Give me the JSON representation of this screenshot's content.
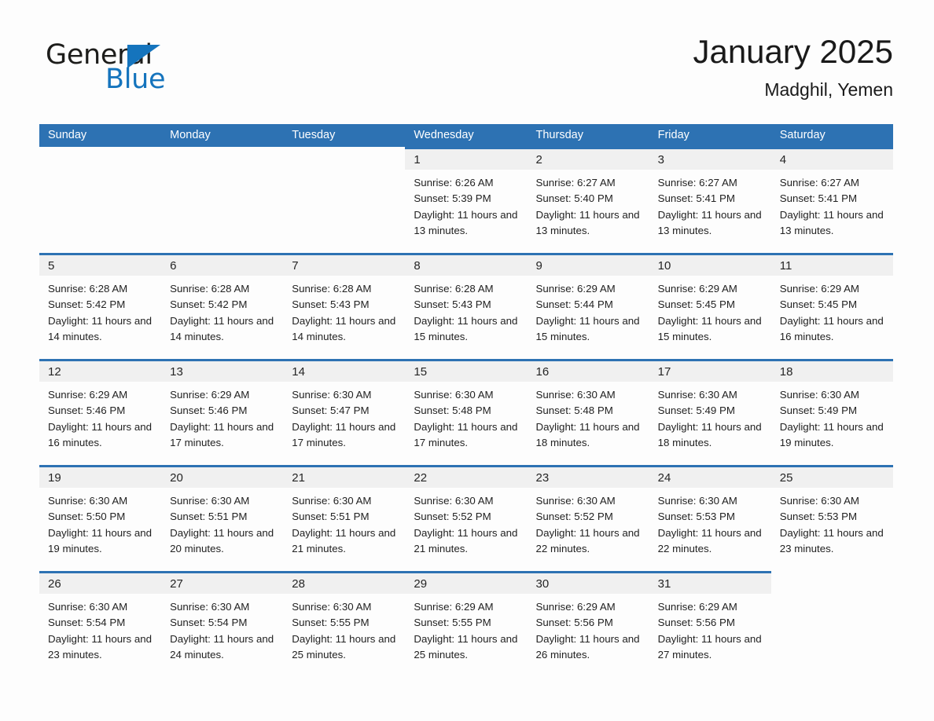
{
  "brand": {
    "name_part1": "General",
    "name_part2": "Blue",
    "accent_color": "#1574bd",
    "triangle_icon": "logo-triangle-icon"
  },
  "header": {
    "month_title": "January 2025",
    "location": "Madghil, Yemen"
  },
  "colors": {
    "header_blue": "#2d72b3",
    "daynum_band": "#f0f0f0",
    "page_background": "#fdfdfd",
    "text": "#222222"
  },
  "weekdays": [
    "Sunday",
    "Monday",
    "Tuesday",
    "Wednesday",
    "Thursday",
    "Friday",
    "Saturday"
  ],
  "weeks": [
    [
      {
        "day": "",
        "blank": true
      },
      {
        "day": "",
        "blank": true
      },
      {
        "day": "",
        "blank": true
      },
      {
        "day": "1",
        "sunrise": "Sunrise: 6:26 AM",
        "sunset": "Sunset: 5:39 PM",
        "daylight": "Daylight: 11 hours and 13 minutes."
      },
      {
        "day": "2",
        "sunrise": "Sunrise: 6:27 AM",
        "sunset": "Sunset: 5:40 PM",
        "daylight": "Daylight: 11 hours and 13 minutes."
      },
      {
        "day": "3",
        "sunrise": "Sunrise: 6:27 AM",
        "sunset": "Sunset: 5:41 PM",
        "daylight": "Daylight: 11 hours and 13 minutes."
      },
      {
        "day": "4",
        "sunrise": "Sunrise: 6:27 AM",
        "sunset": "Sunset: 5:41 PM",
        "daylight": "Daylight: 11 hours and 13 minutes."
      }
    ],
    [
      {
        "day": "5",
        "sunrise": "Sunrise: 6:28 AM",
        "sunset": "Sunset: 5:42 PM",
        "daylight": "Daylight: 11 hours and 14 minutes."
      },
      {
        "day": "6",
        "sunrise": "Sunrise: 6:28 AM",
        "sunset": "Sunset: 5:42 PM",
        "daylight": "Daylight: 11 hours and 14 minutes."
      },
      {
        "day": "7",
        "sunrise": "Sunrise: 6:28 AM",
        "sunset": "Sunset: 5:43 PM",
        "daylight": "Daylight: 11 hours and 14 minutes."
      },
      {
        "day": "8",
        "sunrise": "Sunrise: 6:28 AM",
        "sunset": "Sunset: 5:43 PM",
        "daylight": "Daylight: 11 hours and 15 minutes."
      },
      {
        "day": "9",
        "sunrise": "Sunrise: 6:29 AM",
        "sunset": "Sunset: 5:44 PM",
        "daylight": "Daylight: 11 hours and 15 minutes."
      },
      {
        "day": "10",
        "sunrise": "Sunrise: 6:29 AM",
        "sunset": "Sunset: 5:45 PM",
        "daylight": "Daylight: 11 hours and 15 minutes."
      },
      {
        "day": "11",
        "sunrise": "Sunrise: 6:29 AM",
        "sunset": "Sunset: 5:45 PM",
        "daylight": "Daylight: 11 hours and 16 minutes."
      }
    ],
    [
      {
        "day": "12",
        "sunrise": "Sunrise: 6:29 AM",
        "sunset": "Sunset: 5:46 PM",
        "daylight": "Daylight: 11 hours and 16 minutes."
      },
      {
        "day": "13",
        "sunrise": "Sunrise: 6:29 AM",
        "sunset": "Sunset: 5:46 PM",
        "daylight": "Daylight: 11 hours and 17 minutes."
      },
      {
        "day": "14",
        "sunrise": "Sunrise: 6:30 AM",
        "sunset": "Sunset: 5:47 PM",
        "daylight": "Daylight: 11 hours and 17 minutes."
      },
      {
        "day": "15",
        "sunrise": "Sunrise: 6:30 AM",
        "sunset": "Sunset: 5:48 PM",
        "daylight": "Daylight: 11 hours and 17 minutes."
      },
      {
        "day": "16",
        "sunrise": "Sunrise: 6:30 AM",
        "sunset": "Sunset: 5:48 PM",
        "daylight": "Daylight: 11 hours and 18 minutes."
      },
      {
        "day": "17",
        "sunrise": "Sunrise: 6:30 AM",
        "sunset": "Sunset: 5:49 PM",
        "daylight": "Daylight: 11 hours and 18 minutes."
      },
      {
        "day": "18",
        "sunrise": "Sunrise: 6:30 AM",
        "sunset": "Sunset: 5:49 PM",
        "daylight": "Daylight: 11 hours and 19 minutes."
      }
    ],
    [
      {
        "day": "19",
        "sunrise": "Sunrise: 6:30 AM",
        "sunset": "Sunset: 5:50 PM",
        "daylight": "Daylight: 11 hours and 19 minutes."
      },
      {
        "day": "20",
        "sunrise": "Sunrise: 6:30 AM",
        "sunset": "Sunset: 5:51 PM",
        "daylight": "Daylight: 11 hours and 20 minutes."
      },
      {
        "day": "21",
        "sunrise": "Sunrise: 6:30 AM",
        "sunset": "Sunset: 5:51 PM",
        "daylight": "Daylight: 11 hours and 21 minutes."
      },
      {
        "day": "22",
        "sunrise": "Sunrise: 6:30 AM",
        "sunset": "Sunset: 5:52 PM",
        "daylight": "Daylight: 11 hours and 21 minutes."
      },
      {
        "day": "23",
        "sunrise": "Sunrise: 6:30 AM",
        "sunset": "Sunset: 5:52 PM",
        "daylight": "Daylight: 11 hours and 22 minutes."
      },
      {
        "day": "24",
        "sunrise": "Sunrise: 6:30 AM",
        "sunset": "Sunset: 5:53 PM",
        "daylight": "Daylight: 11 hours and 22 minutes."
      },
      {
        "day": "25",
        "sunrise": "Sunrise: 6:30 AM",
        "sunset": "Sunset: 5:53 PM",
        "daylight": "Daylight: 11 hours and 23 minutes."
      }
    ],
    [
      {
        "day": "26",
        "sunrise": "Sunrise: 6:30 AM",
        "sunset": "Sunset: 5:54 PM",
        "daylight": "Daylight: 11 hours and 23 minutes."
      },
      {
        "day": "27",
        "sunrise": "Sunrise: 6:30 AM",
        "sunset": "Sunset: 5:54 PM",
        "daylight": "Daylight: 11 hours and 24 minutes."
      },
      {
        "day": "28",
        "sunrise": "Sunrise: 6:30 AM",
        "sunset": "Sunset: 5:55 PM",
        "daylight": "Daylight: 11 hours and 25 minutes."
      },
      {
        "day": "29",
        "sunrise": "Sunrise: 6:29 AM",
        "sunset": "Sunset: 5:55 PM",
        "daylight": "Daylight: 11 hours and 25 minutes."
      },
      {
        "day": "30",
        "sunrise": "Sunrise: 6:29 AM",
        "sunset": "Sunset: 5:56 PM",
        "daylight": "Daylight: 11 hours and 26 minutes."
      },
      {
        "day": "31",
        "sunrise": "Sunrise: 6:29 AM",
        "sunset": "Sunset: 5:56 PM",
        "daylight": "Daylight: 11 hours and 27 minutes."
      },
      {
        "day": "",
        "blank": true
      }
    ]
  ]
}
